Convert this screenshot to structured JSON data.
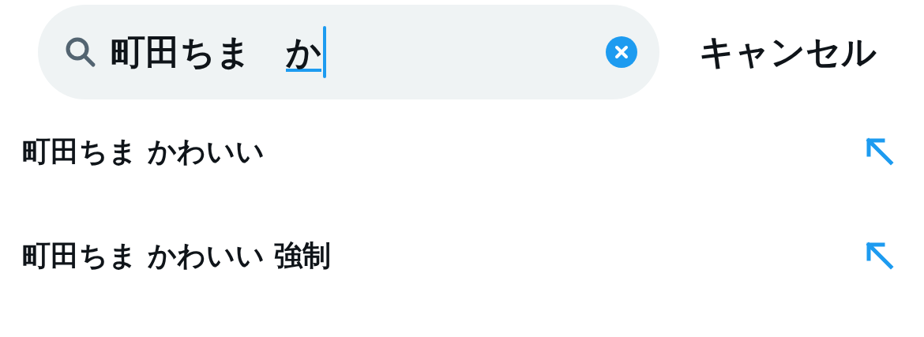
{
  "search": {
    "value": "町田ちま　",
    "composing": "か"
  },
  "cancel": "キャンセル",
  "suggestions": [
    {
      "text": "町田ちま かわいい"
    },
    {
      "text": "町田ちま かわいい 強制"
    }
  ]
}
